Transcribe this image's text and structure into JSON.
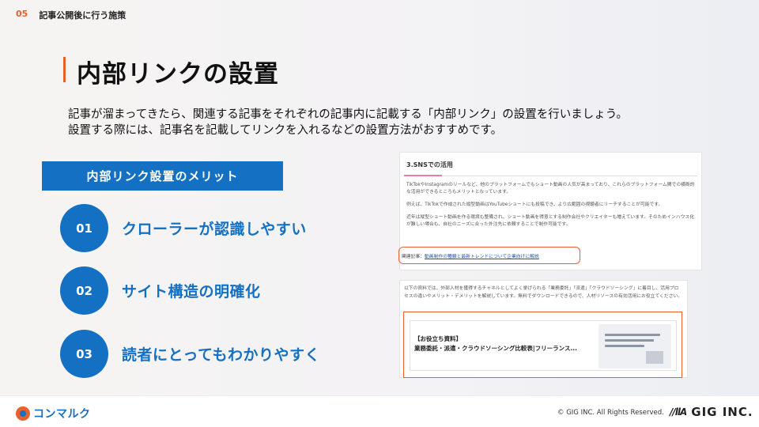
{
  "header": {
    "number": "05",
    "section": "記事公開後に行う施策"
  },
  "title": "内部リンクの設置",
  "description": [
    "記事が溜まってきたら、関連する記事をそれぞれの記事内に記載する「内部リンク」の設置を行いましょう。",
    "設置する際には、記事名を記載してリンクを入れるなどの設置方法がおすすめです。"
  ],
  "merit_label": "内部リンク設置のメリット",
  "merits": [
    {
      "num": "01",
      "text": "クローラーが認識しやすい"
    },
    {
      "num": "02",
      "text": "サイト構造の明確化"
    },
    {
      "num": "03",
      "text": "読者にとってもわかりやすく"
    }
  ],
  "card1": {
    "heading": "3.SNSでの活用",
    "paragraphs": [
      "TikTokやInstagramのリールなど、他のプラットフォームでもショート動画の人気が高まっており、これらのプラットフォーム間での横断的な活用ができるところもメリットとなっています。",
      "例えば、TikTokで作成された縦型動画はYouTubeショートにも投稿でき、より広範囲の視聴者にリーチすることが可能です。",
      "近年は縦型ショート動画を作る環境も整備され、ショート動画を得意とする制作会社やクリエイターも増えています。そのためインハウス化が難しい場合も、自社のニーズに合った外注先に依頼することで制作可能です。"
    ],
    "related_prefix": "関連記事：",
    "related_link": "動画制作の種類と最新トレンドについて企業向けに解説"
  },
  "card2": {
    "paragraph": "以下の資料では、外部人材を獲得するチャネルとしてよく挙げられる「業務委託」「派遣」「クラウドソーシング」に着目し、活用プロセスの違いやメリット・デメリットを解説しています。無料でダウンロードできるので、人材リソースの有効活用にお役立てください。",
    "banner_label": "【お役立ち資料】",
    "banner_title": "業務委託・派遣・クラウドソーシング比較表|フリーランス..."
  },
  "footer": {
    "brand": "コンマルク",
    "copyright": "© GIG INC. All Rights Reserved.",
    "company": "GIG INC."
  }
}
